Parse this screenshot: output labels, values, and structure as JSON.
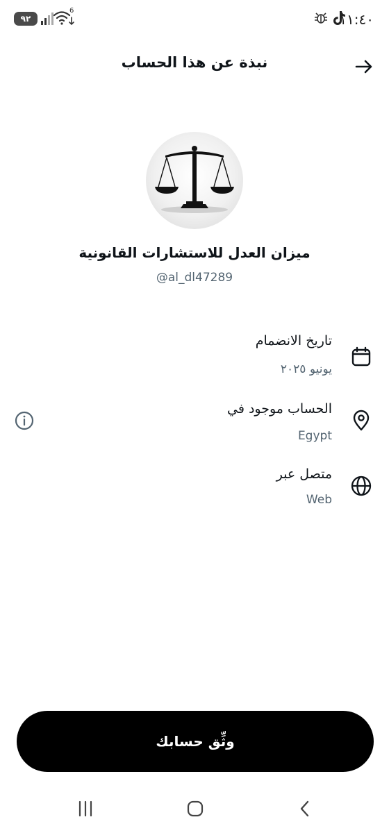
{
  "status_bar": {
    "time": "١١:٤٠",
    "battery": "٩٢",
    "wifi_badge": "6",
    "icons": [
      "tiktok-icon",
      "bug-icon",
      "signal-icon",
      "wifi-icon",
      "battery-icon"
    ]
  },
  "header": {
    "title": "نبذة عن هذا الحساب",
    "back_icon": "arrow-right-icon"
  },
  "profile": {
    "avatar_image": "scales-of-justice",
    "display_name": "ميزان العدل للاستشارات القانونية",
    "handle": "@al_dl47289"
  },
  "info": [
    {
      "icon": "calendar-icon",
      "label": "تاريخ الانضمام",
      "value": "يونيو ٢٠٢٥"
    },
    {
      "icon": "location-pin-icon",
      "label": "الحساب موجود في",
      "value": "Egypt",
      "action_icon": "info-icon"
    },
    {
      "icon": "globe-icon",
      "label": "متصل عبر",
      "value": "Web"
    }
  ],
  "cta": {
    "label": "وثِّق حسابك"
  },
  "nav": {
    "icons": [
      "recents-icon",
      "home-icon",
      "back-chevron-icon"
    ]
  },
  "colors": {
    "text_primary": "#0f1419",
    "text_secondary": "#536471",
    "button_bg": "#000000",
    "button_text": "#ffffff",
    "background": "#ffffff"
  }
}
